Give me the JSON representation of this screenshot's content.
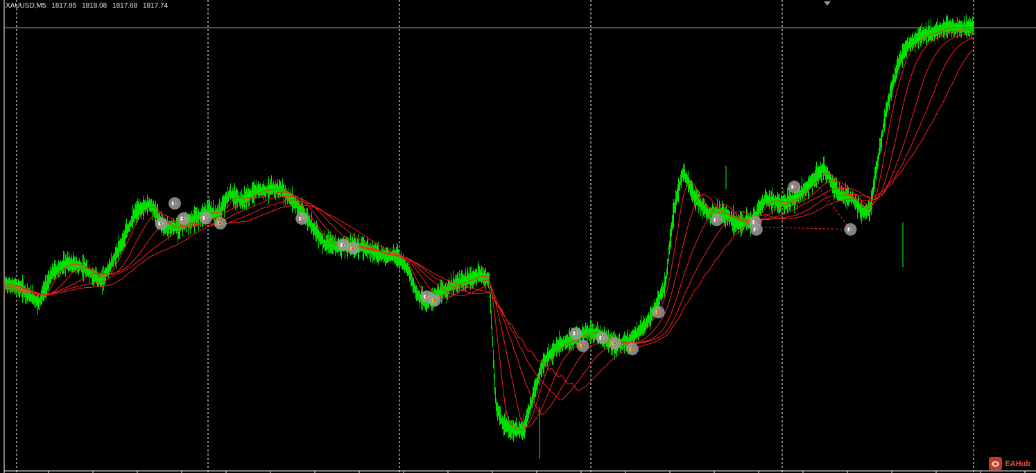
{
  "header": {
    "symbol": "XAUUSD,M5",
    "open": "1817.85",
    "high": "1818.08",
    "low": "1817.68",
    "close": "1817.74"
  },
  "watermark": {
    "text": "EAHub",
    "logo_icon": "eahub-logo-icon"
  },
  "colors": {
    "background": "#000000",
    "candle": "#00e000",
    "moving_average": "#ff2020",
    "grid": "#ffffff",
    "bid_line": "#8a9bb0",
    "signal_circle": "#9a9a9a",
    "signal_arrow_white": "#ffffff",
    "signal_arrow_yellow": "#e6d200"
  },
  "chart_data": {
    "type": "line",
    "symbol": "XAUUSD",
    "timeframe": "M5",
    "vertical_grid": "dashed",
    "price_profile": [
      [
        0.0,
        0.6
      ],
      [
        0.018,
        0.61
      ],
      [
        0.035,
        0.64
      ],
      [
        0.05,
        0.575
      ],
      [
        0.065,
        0.555
      ],
      [
        0.08,
        0.565
      ],
      [
        0.1,
        0.595
      ],
      [
        0.115,
        0.54
      ],
      [
        0.135,
        0.45
      ],
      [
        0.15,
        0.43
      ],
      [
        0.165,
        0.48
      ],
      [
        0.18,
        0.48
      ],
      [
        0.195,
        0.465
      ],
      [
        0.21,
        0.445
      ],
      [
        0.22,
        0.455
      ],
      [
        0.232,
        0.41
      ],
      [
        0.245,
        0.425
      ],
      [
        0.258,
        0.405
      ],
      [
        0.272,
        0.4
      ],
      [
        0.285,
        0.4
      ],
      [
        0.3,
        0.43
      ],
      [
        0.315,
        0.47
      ],
      [
        0.33,
        0.515
      ],
      [
        0.345,
        0.52
      ],
      [
        0.36,
        0.52
      ],
      [
        0.375,
        0.525
      ],
      [
        0.39,
        0.54
      ],
      [
        0.405,
        0.54
      ],
      [
        0.415,
        0.565
      ],
      [
        0.425,
        0.62
      ],
      [
        0.435,
        0.64
      ],
      [
        0.45,
        0.62
      ],
      [
        0.465,
        0.6
      ],
      [
        0.48,
        0.59
      ],
      [
        0.49,
        0.58
      ],
      [
        0.5,
        0.59
      ],
      [
        0.507,
        0.86
      ],
      [
        0.515,
        0.9
      ],
      [
        0.525,
        0.91
      ],
      [
        0.535,
        0.91
      ],
      [
        0.545,
        0.84
      ],
      [
        0.555,
        0.77
      ],
      [
        0.57,
        0.73
      ],
      [
        0.585,
        0.72
      ],
      [
        0.6,
        0.7
      ],
      [
        0.615,
        0.71
      ],
      [
        0.63,
        0.73
      ],
      [
        0.645,
        0.72
      ],
      [
        0.66,
        0.69
      ],
      [
        0.672,
        0.65
      ],
      [
        0.682,
        0.6
      ],
      [
        0.69,
        0.45
      ],
      [
        0.7,
        0.36
      ],
      [
        0.71,
        0.41
      ],
      [
        0.725,
        0.45
      ],
      [
        0.74,
        0.45
      ],
      [
        0.755,
        0.47
      ],
      [
        0.77,
        0.47
      ],
      [
        0.785,
        0.42
      ],
      [
        0.8,
        0.43
      ],
      [
        0.815,
        0.42
      ],
      [
        0.83,
        0.39
      ],
      [
        0.845,
        0.355
      ],
      [
        0.86,
        0.41
      ],
      [
        0.875,
        0.42
      ],
      [
        0.885,
        0.45
      ],
      [
        0.893,
        0.44
      ],
      [
        0.9,
        0.35
      ],
      [
        0.91,
        0.23
      ],
      [
        0.92,
        0.15
      ],
      [
        0.93,
        0.1
      ],
      [
        0.945,
        0.075
      ],
      [
        0.957,
        0.07
      ],
      [
        0.968,
        0.058
      ]
    ],
    "moving_average_lags": [
      0.006,
      0.014,
      0.024,
      0.034,
      0.044
    ],
    "signals": [
      {
        "t": 0.162,
        "p": 0.473,
        "arrow": "white"
      },
      {
        "t": 0.176,
        "p": 0.43,
        "arrow": "white"
      },
      {
        "t": 0.185,
        "p": 0.462,
        "arrow": "white"
      },
      {
        "t": 0.208,
        "p": 0.461,
        "arrow": "white"
      },
      {
        "t": 0.223,
        "p": 0.472,
        "arrow": "yellow"
      },
      {
        "t": 0.307,
        "p": 0.462,
        "arrow": "white"
      },
      {
        "t": 0.35,
        "p": 0.518,
        "arrow": "white"
      },
      {
        "t": 0.36,
        "p": 0.525,
        "arrow": "yellow"
      },
      {
        "t": 0.436,
        "p": 0.627,
        "arrow": "white"
      },
      {
        "t": 0.444,
        "p": 0.635,
        "arrow": "yellow"
      },
      {
        "t": 0.59,
        "p": 0.705,
        "arrow": "white"
      },
      {
        "t": 0.597,
        "p": 0.731,
        "arrow": "yellow"
      },
      {
        "t": 0.617,
        "p": 0.714,
        "arrow": "white"
      },
      {
        "t": 0.63,
        "p": 0.726,
        "arrow": "yellow"
      },
      {
        "t": 0.648,
        "p": 0.738,
        "arrow": "yellow"
      },
      {
        "t": 0.675,
        "p": 0.66,
        "arrow": "yellow"
      },
      {
        "t": 0.735,
        "p": 0.465,
        "arrow": "white"
      },
      {
        "t": 0.775,
        "p": 0.47,
        "arrow": "white"
      },
      {
        "t": 0.776,
        "p": 0.485,
        "arrow": "white"
      },
      {
        "t": 0.815,
        "p": 0.395,
        "arrow": "white"
      },
      {
        "t": 0.873,
        "p": 0.485,
        "arrow": "white"
      }
    ],
    "dashed_links": [
      {
        "from": 0.776,
        "to": 0.873,
        "p_from": 0.48,
        "p_to": 0.485
      },
      {
        "from": 0.84,
        "to": 0.873,
        "p_from": 0.395,
        "p_to": 0.485
      }
    ]
  }
}
